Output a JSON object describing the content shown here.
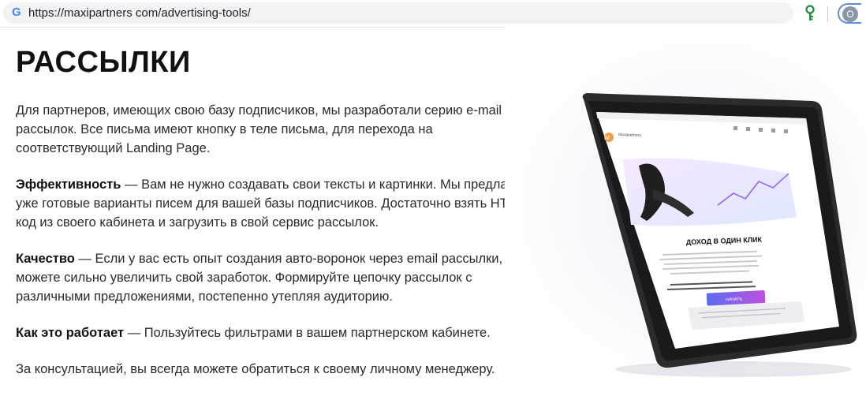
{
  "browser": {
    "url": "https://maxipartners com/advertising-tools/",
    "profile_initial": "О"
  },
  "page": {
    "title": "РАССЫЛКИ",
    "intro": "Для партнеров, имеющих свою базу подписчиков, мы разработали серию e-mail рассылок. Все письма имеют кнопку в теле письма, для перехода на соответствующий Landing Page.",
    "sections": [
      {
        "label": "Эффективность",
        "text": " — Вам не нужно создавать свои тексты и картинки. Мы предлагаем уже готовые варианты писем для вашей базы подписчиков. Достаточно взять HTML код из своего кабинета и загрузить в свой сервис рассылок."
      },
      {
        "label": "Качество",
        "text": " — Если у вас есть опыт создания авто-воронок через email рассылки, вы можете сильно увеличить свой заработок. Формируйте цепочку рассылок с различными предложениями, постепенно утепляя аудиторию."
      },
      {
        "label": "Как это работает",
        "text": " — Пользуйтесь фильтрами в вашем партнерском кабинете."
      }
    ],
    "footer_note": "За консультацией, вы всегда можете обратиться к своему личному менеджеру."
  },
  "tablet": {
    "email_sender": "Maxipartners",
    "email_heading": "ДОХОД В ОДИН КЛИК",
    "cta_label": "НАЧАТЬ",
    "accent_color": "#7b4bd8",
    "avatar_color": "#f0a048"
  }
}
